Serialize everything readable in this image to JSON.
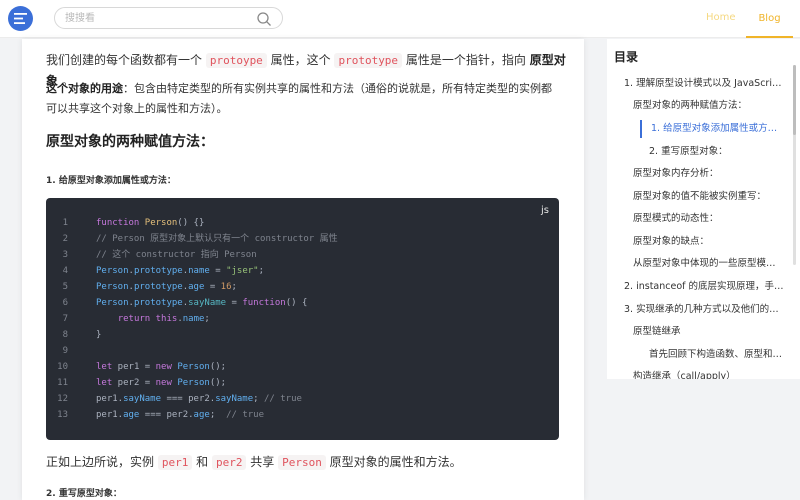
{
  "header": {
    "search_placeholder": "搜搜看",
    "nav": {
      "home": "Home",
      "blog": "Blog"
    },
    "colors": {
      "accent": "#3b6fd8",
      "nav_active": "#f0b429"
    }
  },
  "article": {
    "p1": {
      "a": "我们创建的每个函数都有一个 ",
      "code1": "protoype",
      "b": " 属性，这个 ",
      "code2": "prototype",
      "c": " 属性是一个指针，指向 ",
      "bold": "原型对象",
      "d": " 。"
    },
    "p2": {
      "label": "这个对象的用途",
      "text": "：包含由特定类型的所有实例共享的属性和方法（通俗的说就是，所有特定类型的实例都可以共享这个对象上的属性和方法）。"
    },
    "h2": "原型对象的两种赋值方法：",
    "h4_1": "1. 给原型对象添加属性或方法：",
    "code": {
      "lang": "js",
      "line_numbers": [
        "1",
        "2",
        "3",
        "4",
        "5",
        "6",
        "7",
        "8",
        "9",
        "10",
        "11",
        "12",
        "13"
      ]
    },
    "p3": {
      "a": "正如上边所说，实例 ",
      "code1": "per1",
      "b": " 和 ",
      "code2": "per2",
      "c": " 共享 ",
      "code3": "Person",
      "d": " 原型对象的属性和方法。"
    },
    "h4_2": "2. 重写原型对象："
  },
  "toc": {
    "title": "目录",
    "items": [
      "1. 理解原型设计模式以及 JavaScript中的原型规则",
      "原型对象的两种赋值方法：",
      "1. 给原型对象添加属性或方法：",
      "2. 重写原型对象：",
      "原型对象内存分析：",
      "原型对象的值不能被实例重写：",
      "原型模式的动态性：",
      "原型对象的缺点：",
      "从原型对象中体现的一些原型模式的缺点",
      "2. instanceof 的底层实现原理，手动实现一个 instanceof",
      "3. 实现继承的几种方式以及他们的优缺点",
      "原型链继承",
      "首先回顾下构造函数、原型和实例的关系",
      "构造继承（call/apply）"
    ]
  }
}
